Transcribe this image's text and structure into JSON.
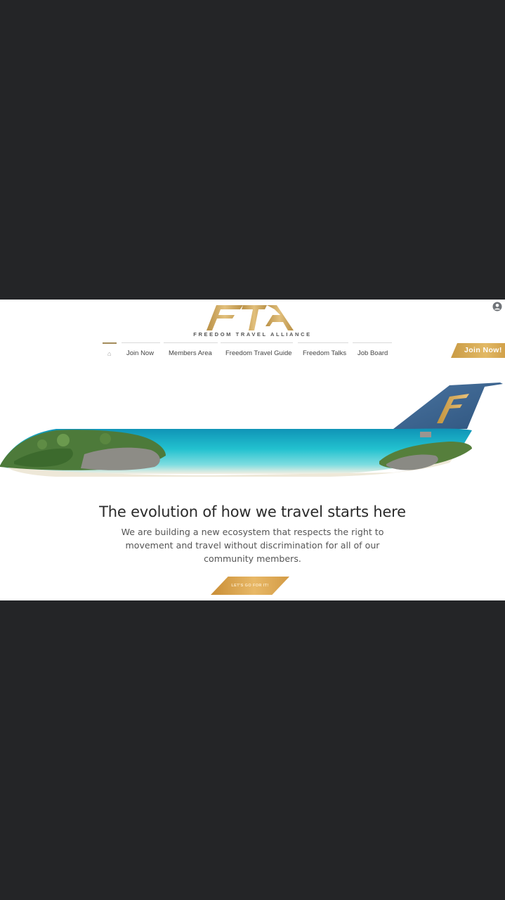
{
  "brand": {
    "logo_text": "FTA",
    "name": "FREEDOM TRAVEL ALLIANCE"
  },
  "nav": {
    "home_icon": "⌂",
    "items": [
      {
        "label": "Join Now"
      },
      {
        "label": "Members Area"
      },
      {
        "label": "Freedom Travel Guide"
      },
      {
        "label": "Freedom Talks"
      },
      {
        "label": "Job Board"
      }
    ]
  },
  "join_button": {
    "label": "Join Now!"
  },
  "hero": {
    "headline": "The evolution of how we travel starts here",
    "subtext": "We are building a new ecosystem that respects the right to movement and travel without discrimination for all of our community members.",
    "cta_label": "LET'S GO FOR IT!"
  },
  "colors": {
    "gold": "#d4a85a",
    "background": "#242527",
    "tail_blue": "#3f6690"
  },
  "icons": {
    "user": "account-circle-icon",
    "home": "home-icon"
  }
}
